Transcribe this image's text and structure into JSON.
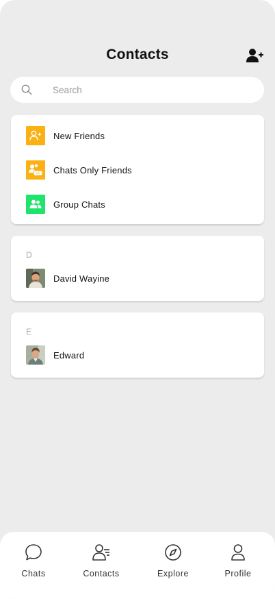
{
  "header": {
    "title": "Contacts"
  },
  "search": {
    "placeholder": "Search"
  },
  "menu": {
    "new_friends": "New Friends",
    "chats_only_friends": "Chats Only Friends",
    "group_chats": "Group Chats"
  },
  "sections": [
    {
      "letter": "D",
      "name": "David Wayine"
    },
    {
      "letter": "E",
      "name": "Edward"
    }
  ],
  "tabs": [
    {
      "label": "Chats"
    },
    {
      "label": "Contacts"
    },
    {
      "label": "Explore"
    },
    {
      "label": "Profile"
    }
  ],
  "colors": {
    "orange": "#fbb014",
    "green": "#1fe36a",
    "background": "#ececec"
  }
}
